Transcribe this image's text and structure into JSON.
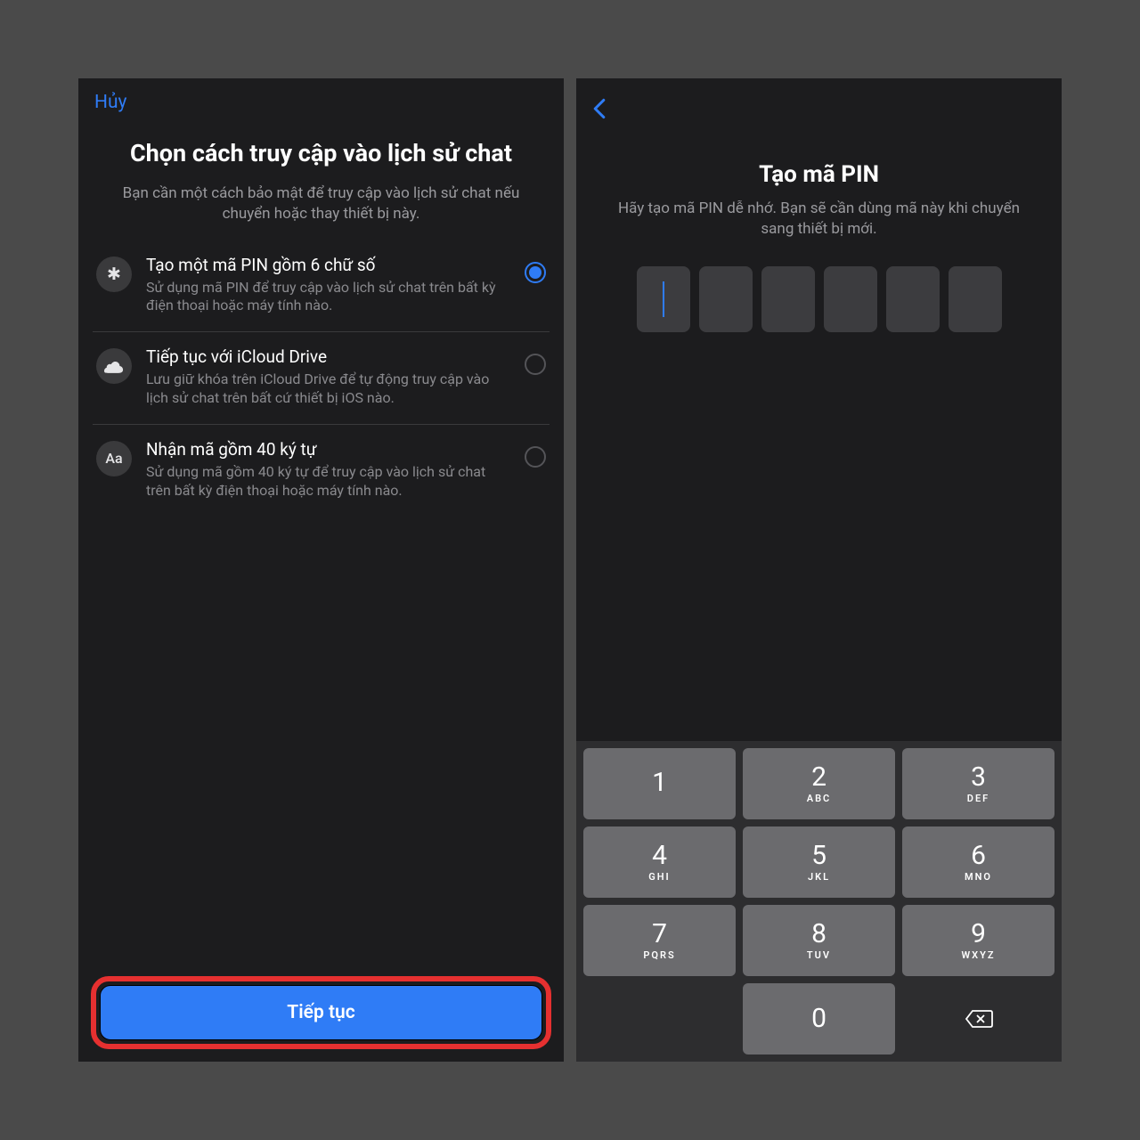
{
  "left": {
    "cancel": "Hủy",
    "title": "Chọn cách truy cập vào lịch sử chat",
    "subtitle": "Bạn cần một cách bảo mật để truy cập vào lịch sử chat nếu chuyển hoặc thay thiết bị này.",
    "options": [
      {
        "icon": "✱",
        "title": "Tạo một mã PIN gồm 6 chữ số",
        "desc": "Sử dụng mã PIN để truy cập vào lịch sử chat trên bất kỳ điện thoại hoặc máy tính nào.",
        "selected": true
      },
      {
        "icon": "cloud",
        "title": "Tiếp tục với iCloud Drive",
        "desc": "Lưu giữ khóa trên iCloud Drive để tự động truy cập vào lịch sử chat trên bất cứ thiết bị iOS nào.",
        "selected": false
      },
      {
        "icon": "Aa",
        "title": "Nhận mã gồm 40 ký tự",
        "desc": "Sử dụng mã gồm 40 ký tự để truy cập vào lịch sử chat trên bất kỳ điện thoại hoặc máy tính nào.",
        "selected": false
      }
    ],
    "continue": "Tiếp tục"
  },
  "right": {
    "title": "Tạo mã PIN",
    "subtitle": "Hãy tạo mã PIN dễ nhớ. Bạn sẽ cần dùng mã này khi chuyển sang thiết bị mới.",
    "pin_length": 6,
    "keypad": [
      {
        "num": "1",
        "letters": ""
      },
      {
        "num": "2",
        "letters": "ABC"
      },
      {
        "num": "3",
        "letters": "DEF"
      },
      {
        "num": "4",
        "letters": "GHI"
      },
      {
        "num": "5",
        "letters": "JKL"
      },
      {
        "num": "6",
        "letters": "MNO"
      },
      {
        "num": "7",
        "letters": "PQRS"
      },
      {
        "num": "8",
        "letters": "TUV"
      },
      {
        "num": "9",
        "letters": "WXYZ"
      },
      {
        "num": "0",
        "letters": ""
      }
    ]
  }
}
